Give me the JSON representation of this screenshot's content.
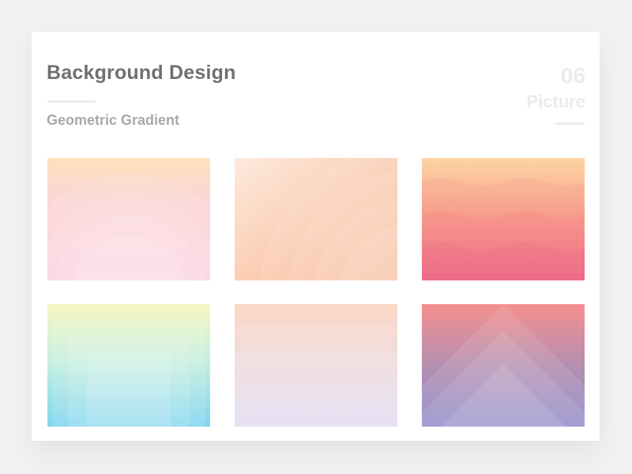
{
  "header": {
    "title": "Background Design",
    "subtitle": "Geometric Gradient",
    "number": "06",
    "tag": "Picture"
  },
  "thumbnails": [
    {
      "name": "pink-arcs",
      "colors": [
        "#fde2ba",
        "#fcd0e0"
      ]
    },
    {
      "name": "peach-circles",
      "colors": [
        "#fde9da",
        "#f9b590"
      ]
    },
    {
      "name": "coral-waves",
      "colors": [
        "#fdd3a2",
        "#f26c8b"
      ]
    },
    {
      "name": "cyan-frames",
      "colors": [
        "#f6f5c0",
        "#80d5f0"
      ]
    },
    {
      "name": "lavender-stripes",
      "colors": [
        "#fbd8c7",
        "#ded4f1"
      ]
    },
    {
      "name": "purple-triangles",
      "colors": [
        "#f58f8e",
        "#8c87ca"
      ]
    }
  ]
}
